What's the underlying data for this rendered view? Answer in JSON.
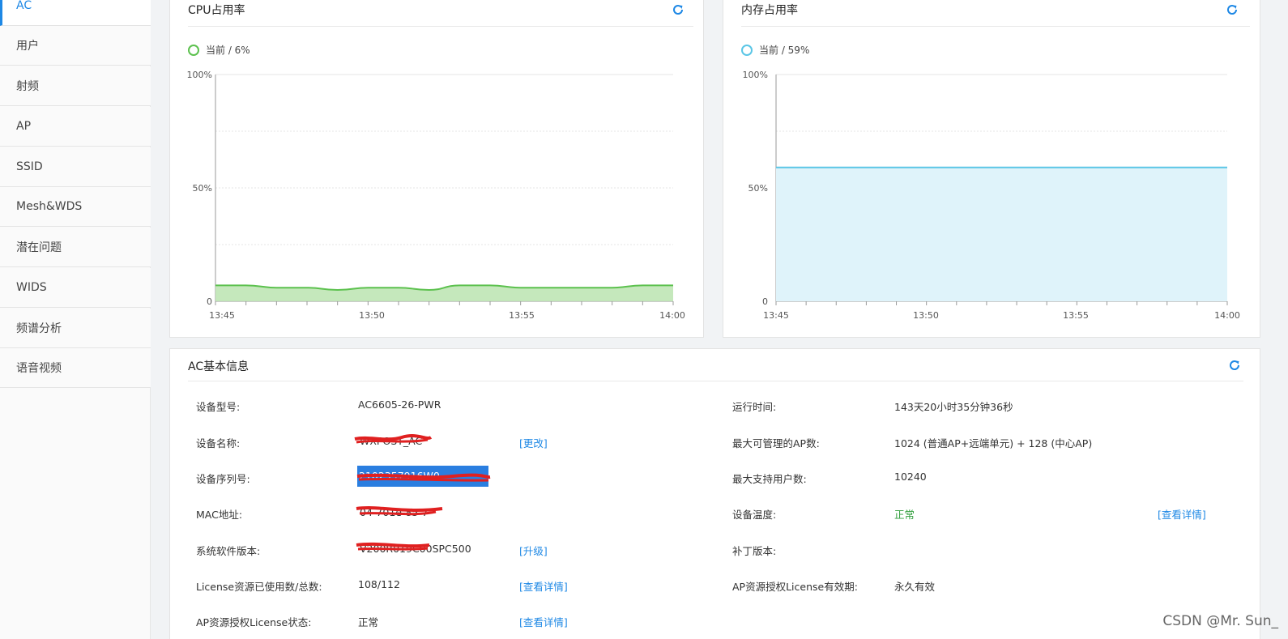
{
  "sidebar": {
    "items": [
      {
        "label": "AC",
        "active": true
      },
      {
        "label": "用户"
      },
      {
        "label": "射频"
      },
      {
        "label": "AP"
      },
      {
        "label": "SSID"
      },
      {
        "label": "Mesh&WDS"
      },
      {
        "label": "潜在问题"
      },
      {
        "label": "WIDS"
      },
      {
        "label": "频谱分析"
      },
      {
        "label": "语音视频"
      }
    ]
  },
  "cpu": {
    "title": "CPU占用率",
    "legend": "当前 / 6%",
    "color": "#5cc14e",
    "y_ticks": [
      "100%",
      "50%",
      "0"
    ],
    "x_ticks": [
      "13:45",
      "13:50",
      "13:55",
      "14:00"
    ]
  },
  "mem": {
    "title": "内存占用率",
    "legend": "当前 / 59%",
    "color": "#5bc6e6",
    "y_ticks": [
      "100%",
      "50%",
      "0"
    ],
    "x_ticks": [
      "13:45",
      "13:50",
      "13:55",
      "14:00"
    ]
  },
  "chart_data": [
    {
      "type": "area",
      "title": "CPU占用率",
      "x": [
        "13:45",
        "13:46",
        "13:47",
        "13:48",
        "13:49",
        "13:50",
        "13:51",
        "13:52",
        "13:53",
        "13:54",
        "13:55",
        "13:56",
        "13:57",
        "13:58",
        "13:59",
        "14:00"
      ],
      "values": [
        7,
        7,
        6,
        6,
        5,
        6,
        6,
        5,
        7,
        7,
        6,
        6,
        6,
        6,
        7,
        7
      ],
      "ylim": [
        0,
        100
      ],
      "color": "#5cc14e"
    },
    {
      "type": "area",
      "title": "内存占用率",
      "x": [
        "13:45",
        "14:00"
      ],
      "values": [
        59,
        59
      ],
      "ylim": [
        0,
        100
      ],
      "color": "#5bc6e6"
    }
  ],
  "basic": {
    "title": "AC基本信息",
    "rows": [
      {
        "label": "设备型号:",
        "value": "AC6605-26-PWR",
        "link": "",
        "label2": "运行时间:",
        "value2": "143天20小时35分钟36秒",
        "link2": ""
      },
      {
        "label": "设备名称:",
        "value": "WXPOST_AC",
        "link": "[更改]",
        "label2": "最大可管理的AP数:",
        "value2": "1024 (普通AP+远端单元) + 128 (中心AP)",
        "link2": ""
      },
      {
        "label": "设备序列号:",
        "value": "2102357916W0",
        "link": "",
        "label2": "最大支持用户数:",
        "value2": "10240",
        "link2": ""
      },
      {
        "label": "MAC地址:",
        "value": "04-701e-85-7",
        "link": "",
        "label2": "设备温度:",
        "value2": "正常",
        "link2": "[查看详情]"
      },
      {
        "label": "系统软件版本:",
        "value": "V200R019C00SPC500",
        "link": "[升级]",
        "label2": "补丁版本:",
        "value2": "",
        "link2": ""
      },
      {
        "label": "License资源已使用数/总数:",
        "value": "108/112",
        "link": "[查看详情]",
        "label2": "AP资源授权License有效期:",
        "value2": "永久有效",
        "link2": ""
      },
      {
        "label": "AP资源授权License状态:",
        "value": "正常",
        "link": "[查看详情]",
        "label2": "",
        "value2": "",
        "link2": ""
      }
    ]
  },
  "watermark": "CSDN @Mr. Sun_"
}
